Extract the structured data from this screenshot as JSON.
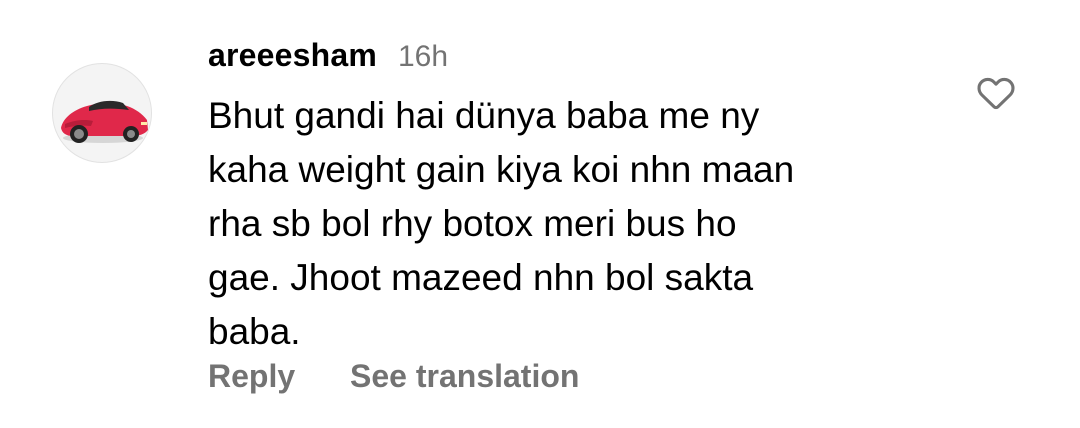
{
  "comment": {
    "username": "areeesham",
    "time": "16h",
    "lines": [
      "Bhut gandi hai dünya baba me ny",
      "kaha weight gain kiya koi nhn maan",
      "rha sb bol rhy botox meri bus ho",
      "gae. Jhoot mazeed nhn bol sakta",
      "baba."
    ],
    "actions": {
      "reply_label": "Reply",
      "translate_label": "See translation"
    },
    "icons": {
      "like": "heart-icon",
      "avatar": "red-sports-car"
    }
  },
  "colors": {
    "text": "#000000",
    "secondary": "#737373",
    "avatar_car": "#e0284a"
  }
}
